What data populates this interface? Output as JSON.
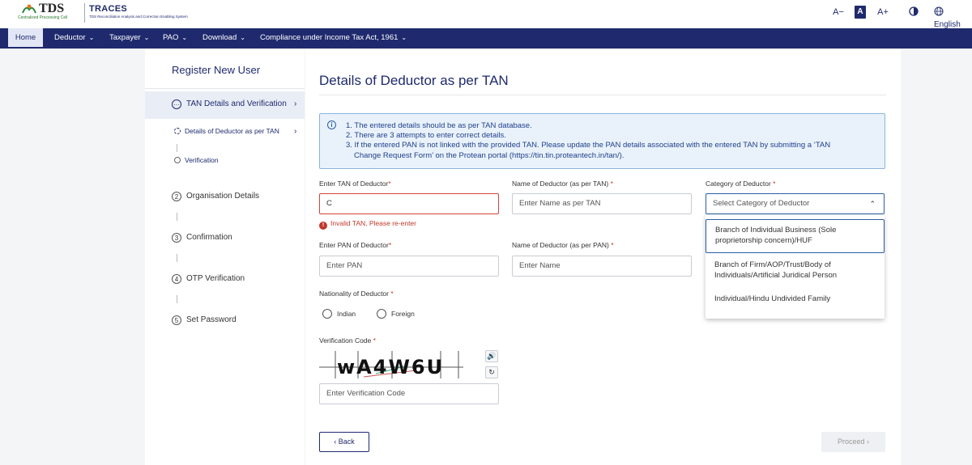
{
  "header": {
    "logo_text": "TDS",
    "logo_subtext": "Centralized Processing Cell",
    "brand_title": "TRACES",
    "brand_subtitle": "TDS Reconciliation Analysis and Correction Enabling System",
    "font_decrease": "A−",
    "font_normal": "A",
    "font_increase": "A+",
    "language": "English"
  },
  "nav": {
    "items": [
      {
        "label": "Home"
      },
      {
        "label": "Deductor"
      },
      {
        "label": "Taxpayer"
      },
      {
        "label": "PAO"
      },
      {
        "label": "Download"
      },
      {
        "label": "Compliance under Income Tax Act, 1961"
      }
    ]
  },
  "sidebar": {
    "title": "Register New User",
    "steps": [
      {
        "num": "",
        "label": "TAN Details and Verification"
      },
      {
        "num": "2",
        "label": "Organisation Details"
      },
      {
        "num": "3",
        "label": "Confirmation"
      },
      {
        "num": "4",
        "label": "OTP Verification"
      },
      {
        "num": "5",
        "label": "Set Password"
      }
    ],
    "substeps": [
      {
        "label": "Details of Deductor as per TAN"
      },
      {
        "label": "Verification"
      }
    ]
  },
  "main": {
    "title": "Details of Deductor as per TAN",
    "info_lines": [
      "1. The entered details should be as per TAN database.",
      "2. There are 3 attempts to enter correct details.",
      "3. If the entered PAN is not linked with the provided TAN. Please update the PAN details associated with the entered TAN by submitting a ‘TAN",
      "Change Request Form’ on the Protean portal (https://tin.tin.proteantech.in/tan/)."
    ],
    "tan_label": "Enter TAN of Deductor",
    "tan_value": "C",
    "tan_error": "Invalid TAN, Please re-enter",
    "name_tan_label": "Name of Deductor (as per TAN)",
    "name_tan_placeholder": "Enter Name as per TAN",
    "category_label": "Category of Deductor",
    "category_placeholder": "Select Category of Deductor",
    "pan_label": "Enter PAN of Deductor",
    "pan_placeholder": "Enter PAN",
    "name_pan_label": "Name of Deductor (as per PAN)",
    "name_pan_placeholder": "Enter Name",
    "nationality_label": "Nationality of Deductor",
    "nationality_options": [
      "Indian",
      "Foreign"
    ],
    "verification_label": "Verification Code",
    "captcha_text": "wA4W6U",
    "verification_placeholder": "Enter Verification Code",
    "back_label": "Back",
    "proceed_label": "Proceed",
    "required_mark": "*"
  },
  "dropdown": {
    "options": [
      [
        "Branch of Individual Business (Sole",
        "proprietorship concern)/HUF"
      ],
      [
        "Branch of Firm/AOP/Trust/Body of",
        "Individuals/Artificial Juridical Person"
      ],
      [
        "Individual/Hindu Undivided Family"
      ]
    ]
  },
  "colors": {
    "primary": "#1f2a6e",
    "error": "#c0392b",
    "info_bg": "#e9f2fb"
  }
}
